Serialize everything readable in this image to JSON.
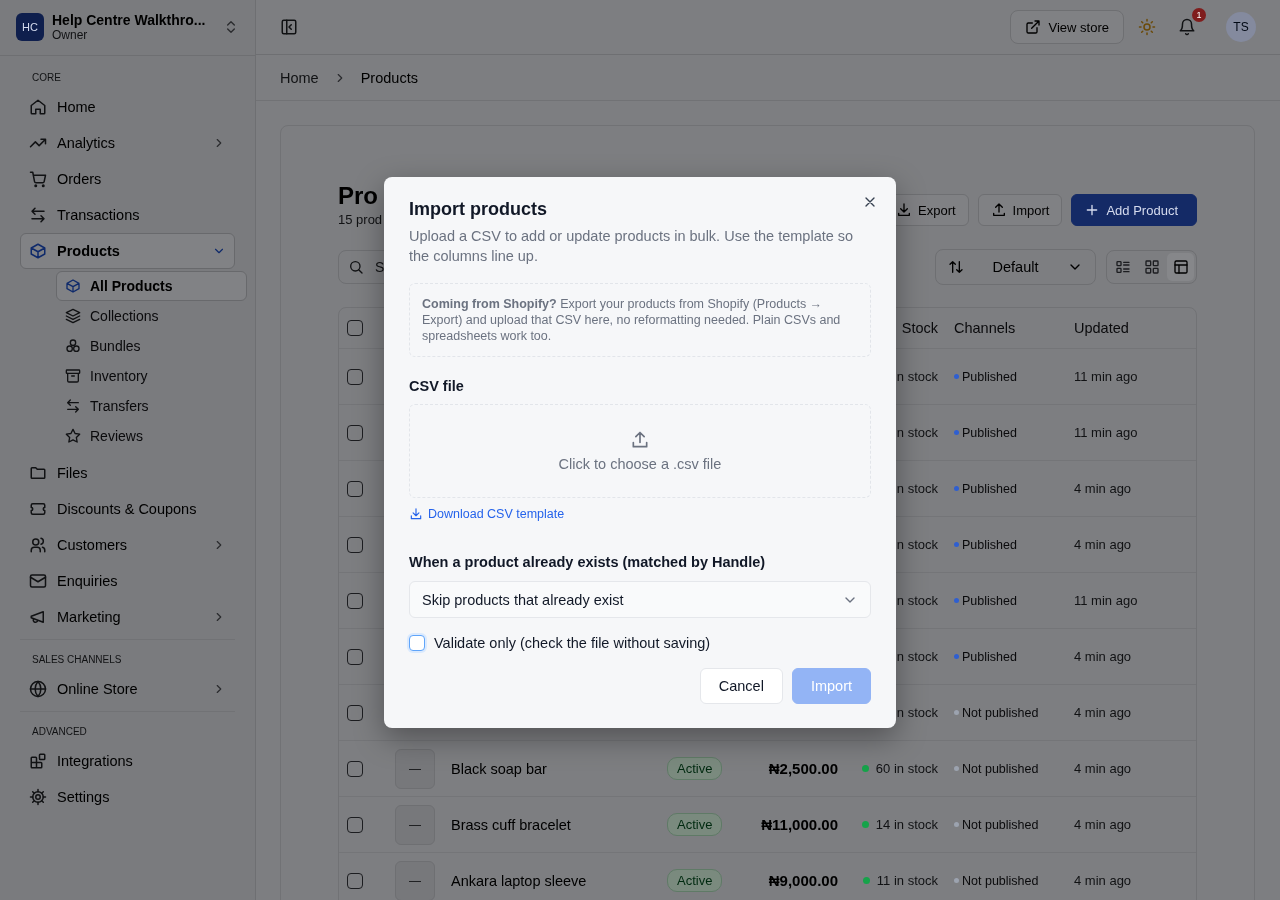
{
  "sidebar": {
    "brand": {
      "initials": "HC",
      "name": "Help Centre Walkthro...",
      "role": "Owner"
    },
    "sections": [
      {
        "heading": "CORE",
        "items": [
          {
            "label": "Home",
            "kind": "link",
            "selected": false
          },
          {
            "label": "Analytics",
            "kind": "group",
            "expanded": false,
            "selected": false
          },
          {
            "label": "Orders",
            "kind": "link",
            "selected": false
          },
          {
            "label": "Transactions",
            "kind": "link",
            "selected": false
          },
          {
            "label": "Products",
            "kind": "group",
            "expanded": true,
            "selected": true,
            "children": [
              {
                "label": "All Products",
                "selected": true
              },
              {
                "label": "Collections",
                "selected": false
              },
              {
                "label": "Bundles",
                "selected": false
              },
              {
                "label": "Inventory",
                "selected": false
              },
              {
                "label": "Transfers",
                "selected": false
              },
              {
                "label": "Reviews",
                "selected": false
              }
            ]
          },
          {
            "label": "Files",
            "kind": "link",
            "selected": false
          },
          {
            "label": "Discounts & Coupons",
            "kind": "link",
            "selected": false
          },
          {
            "label": "Customers",
            "kind": "group",
            "expanded": false,
            "selected": false
          },
          {
            "label": "Enquiries",
            "kind": "link",
            "selected": false
          },
          {
            "label": "Marketing",
            "kind": "group",
            "expanded": false,
            "selected": false
          }
        ]
      },
      {
        "heading": "SALES CHANNELS",
        "items": [
          {
            "label": "Online Store",
            "kind": "group",
            "expanded": false,
            "selected": false
          }
        ]
      },
      {
        "heading": "ADVANCED",
        "items": [
          {
            "label": "Integrations",
            "kind": "link",
            "selected": false
          },
          {
            "label": "Settings",
            "kind": "link",
            "selected": false
          }
        ]
      }
    ]
  },
  "topbar": {
    "view_store": "View store",
    "notification_count": "1",
    "avatar": "TS"
  },
  "breadcrumb": [
    "Home",
    "Products"
  ],
  "page": {
    "title": "Pro",
    "subtitle": "15 prod",
    "actions": [
      {
        "label": "Export",
        "kind": "secondary"
      },
      {
        "label": "Import",
        "kind": "secondary"
      },
      {
        "label": "Add Product",
        "kind": "primary"
      }
    ],
    "search": {
      "placeholder": "S"
    },
    "sort": {
      "value": "Default"
    },
    "view_modes": [
      {
        "selected": false
      },
      {
        "selected": false
      },
      {
        "selected": true
      }
    ]
  },
  "table": {
    "columns": [
      {
        "label": "Stock"
      },
      {
        "label": "Channels"
      },
      {
        "label": "Updated"
      }
    ],
    "header_checked": false,
    "rows": [
      {
        "checked": false,
        "stock": {
          "label": "n stock"
        },
        "channel": {
          "label": "Published",
          "color": "#2f5fd0"
        },
        "updated": "11 min ago"
      },
      {
        "checked": false,
        "stock": {
          "label": "n stock"
        },
        "channel": {
          "label": "Published",
          "color": "#2f5fd0"
        },
        "updated": "11 min ago"
      },
      {
        "checked": false,
        "stock": {
          "label": "n stock"
        },
        "channel": {
          "label": "Published",
          "color": "#2f5fd0"
        },
        "updated": "4 min ago"
      },
      {
        "checked": false,
        "stock": {
          "label": "n stock"
        },
        "channel": {
          "label": "Published",
          "color": "#2f5fd0"
        },
        "updated": "4 min ago"
      },
      {
        "checked": false,
        "stock": {
          "label": "n stock"
        },
        "channel": {
          "label": "Published",
          "color": "#2f5fd0"
        },
        "updated": "11 min ago"
      },
      {
        "checked": false,
        "stock": {
          "label": "n stock"
        },
        "channel": {
          "label": "Published",
          "color": "#2f5fd0"
        },
        "updated": "4 min ago"
      },
      {
        "checked": false,
        "stock": {
          "label": "n stock"
        },
        "channel": {
          "label": "Not published",
          "color": "#9ca3af"
        },
        "updated": "4 min ago"
      },
      {
        "checked": false,
        "thumb": "—",
        "name": "Black soap bar",
        "status": "Active",
        "price": "₦2,500.00",
        "stock": {
          "label": "60 in stock",
          "color": "#16a34a"
        },
        "channel": {
          "label": "Not published",
          "color": "#9ca3af"
        },
        "updated": "4 min ago"
      },
      {
        "checked": false,
        "thumb": "—",
        "name": "Brass cuff bracelet",
        "status": "Active",
        "price": "₦11,000.00",
        "stock": {
          "label": "14 in stock",
          "color": "#16a34a"
        },
        "channel": {
          "label": "Not published",
          "color": "#9ca3af"
        },
        "updated": "4 min ago"
      },
      {
        "checked": false,
        "thumb": "—",
        "name": "Ankara laptop sleeve",
        "status": "Active",
        "price": "₦9,000.00",
        "stock": {
          "label": "11 in stock",
          "color": "#16a34a"
        },
        "channel": {
          "label": "Not published",
          "color": "#9ca3af"
        },
        "updated": "4 min ago"
      }
    ]
  },
  "modal": {
    "title": "Import products",
    "description": "Upload a CSV to add or update products in bulk. Use the template so the columns line up.",
    "notice": "**Coming from Shopify?** Export your products from Shopify (Products → Export) and upload that CSV here, no reformatting needed. Plain CSVs and spreadsheets work too.",
    "file_label": "CSV file",
    "dropzone": "Click to choose a .csv file",
    "template_link": "Download CSV template",
    "existing_label": "When a product already exists (matched by Handle)",
    "existing_value": "Skip products that already exist",
    "validate": {
      "label": "Validate only (check the file without saving)",
      "checked": false
    },
    "buttons": [
      {
        "label": "Cancel",
        "kind": "secondary",
        "disabled": false
      },
      {
        "label": "Import",
        "kind": "primary",
        "disabled": true
      }
    ]
  }
}
